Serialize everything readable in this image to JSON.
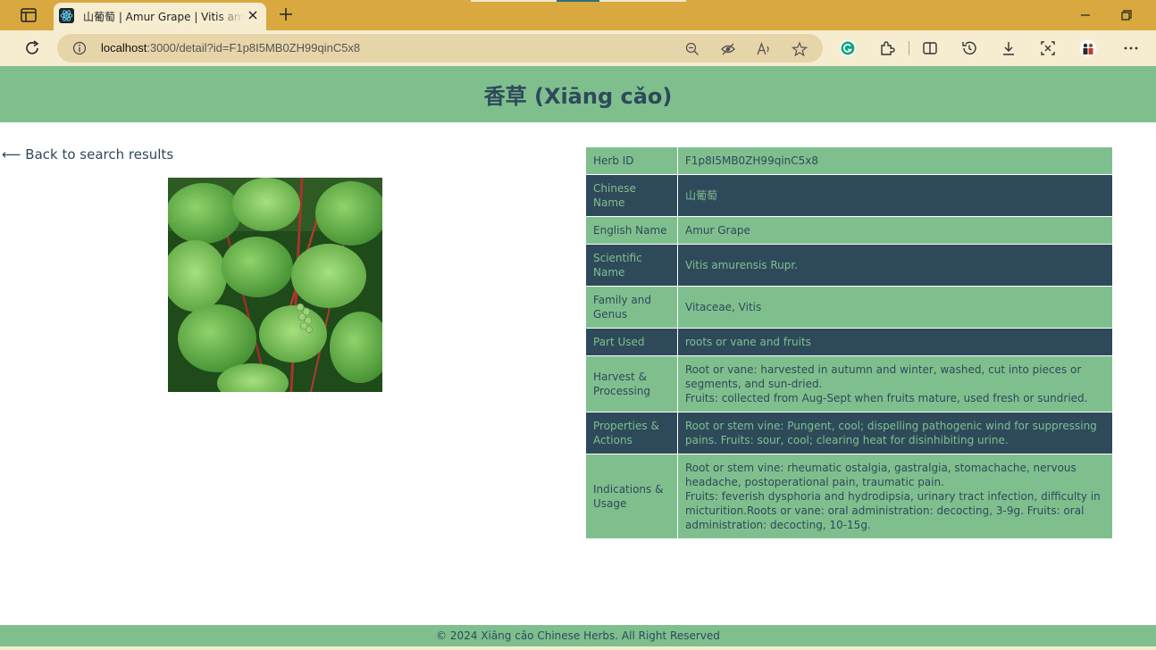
{
  "browser": {
    "tab_title": "山葡萄 | Amur Grape | Vitis amurensis",
    "url_host": "localhost",
    "url_rest": ":3000/detail?id=F1p8I5MB0ZH99qinC5x8",
    "icons": [
      "sidebar-toggle-icon",
      "react-favicon-icon",
      "close-icon",
      "new-tab-icon",
      "minimize-icon",
      "restore-icon",
      "reload-icon",
      "info-icon",
      "zoom-out-icon",
      "tracking-prevention-icon",
      "read-aloud-icon",
      "favorite-star-icon",
      "grammarly-icon",
      "extensions-icon",
      "split-screen-icon",
      "history-icon",
      "downloads-icon",
      "screenshot-icon",
      "profile-icon",
      "more-icon"
    ]
  },
  "header": {
    "title": "香草 (Xiāng cǎo)"
  },
  "back_link": "⟵ Back to search results",
  "herb": {
    "rows": [
      {
        "key": "Herb ID",
        "value": "F1p8I5MB0ZH99qinC5x8"
      },
      {
        "key": "Chinese Name",
        "value": "山葡萄"
      },
      {
        "key": "English Name",
        "value": "Amur Grape"
      },
      {
        "key": "Scientific Name",
        "value": "Vitis amurensis Rupr."
      },
      {
        "key": "Family and Genus",
        "value": "Vitaceae, Vitis"
      },
      {
        "key": "Part Used",
        "value": "roots or vane and fruits"
      },
      {
        "key": "Harvest & Processing",
        "value": "Root or vane: harvested in autumn and winter, washed, cut into pieces or segments, and sun-dried.\nFruits: collected from Aug-Sept when fruits mature, used fresh or sundried."
      },
      {
        "key": "Properties & Actions",
        "value": "Root or stem vine: Pungent, cool; dispelling pathogenic wind for suppressing pains. Fruits: sour, cool; clearing heat for disinhibiting urine."
      },
      {
        "key": "Indications & Usage",
        "value": "Root or stem vine: rheumatic ostalgia, gastralgia, stomachache, nervous headache, postoperational pain, traumatic pain.\nFruits: feverish dysphoria and hydrodipsia, urinary tract infection, difficulty in micturition.Roots or vane: oral administration: decocting, 3-9g. Fruits: oral administration: decocting, 10-15g."
      }
    ]
  },
  "footer": {
    "text": "© 2024 Xiāng cǎo Chinese Herbs. All Right Reserved"
  },
  "colors": {
    "green": "#7fbf8e",
    "navy": "#2e4a5a",
    "chrome": "#d9a83f",
    "chrome_light": "#f6ecd0"
  }
}
